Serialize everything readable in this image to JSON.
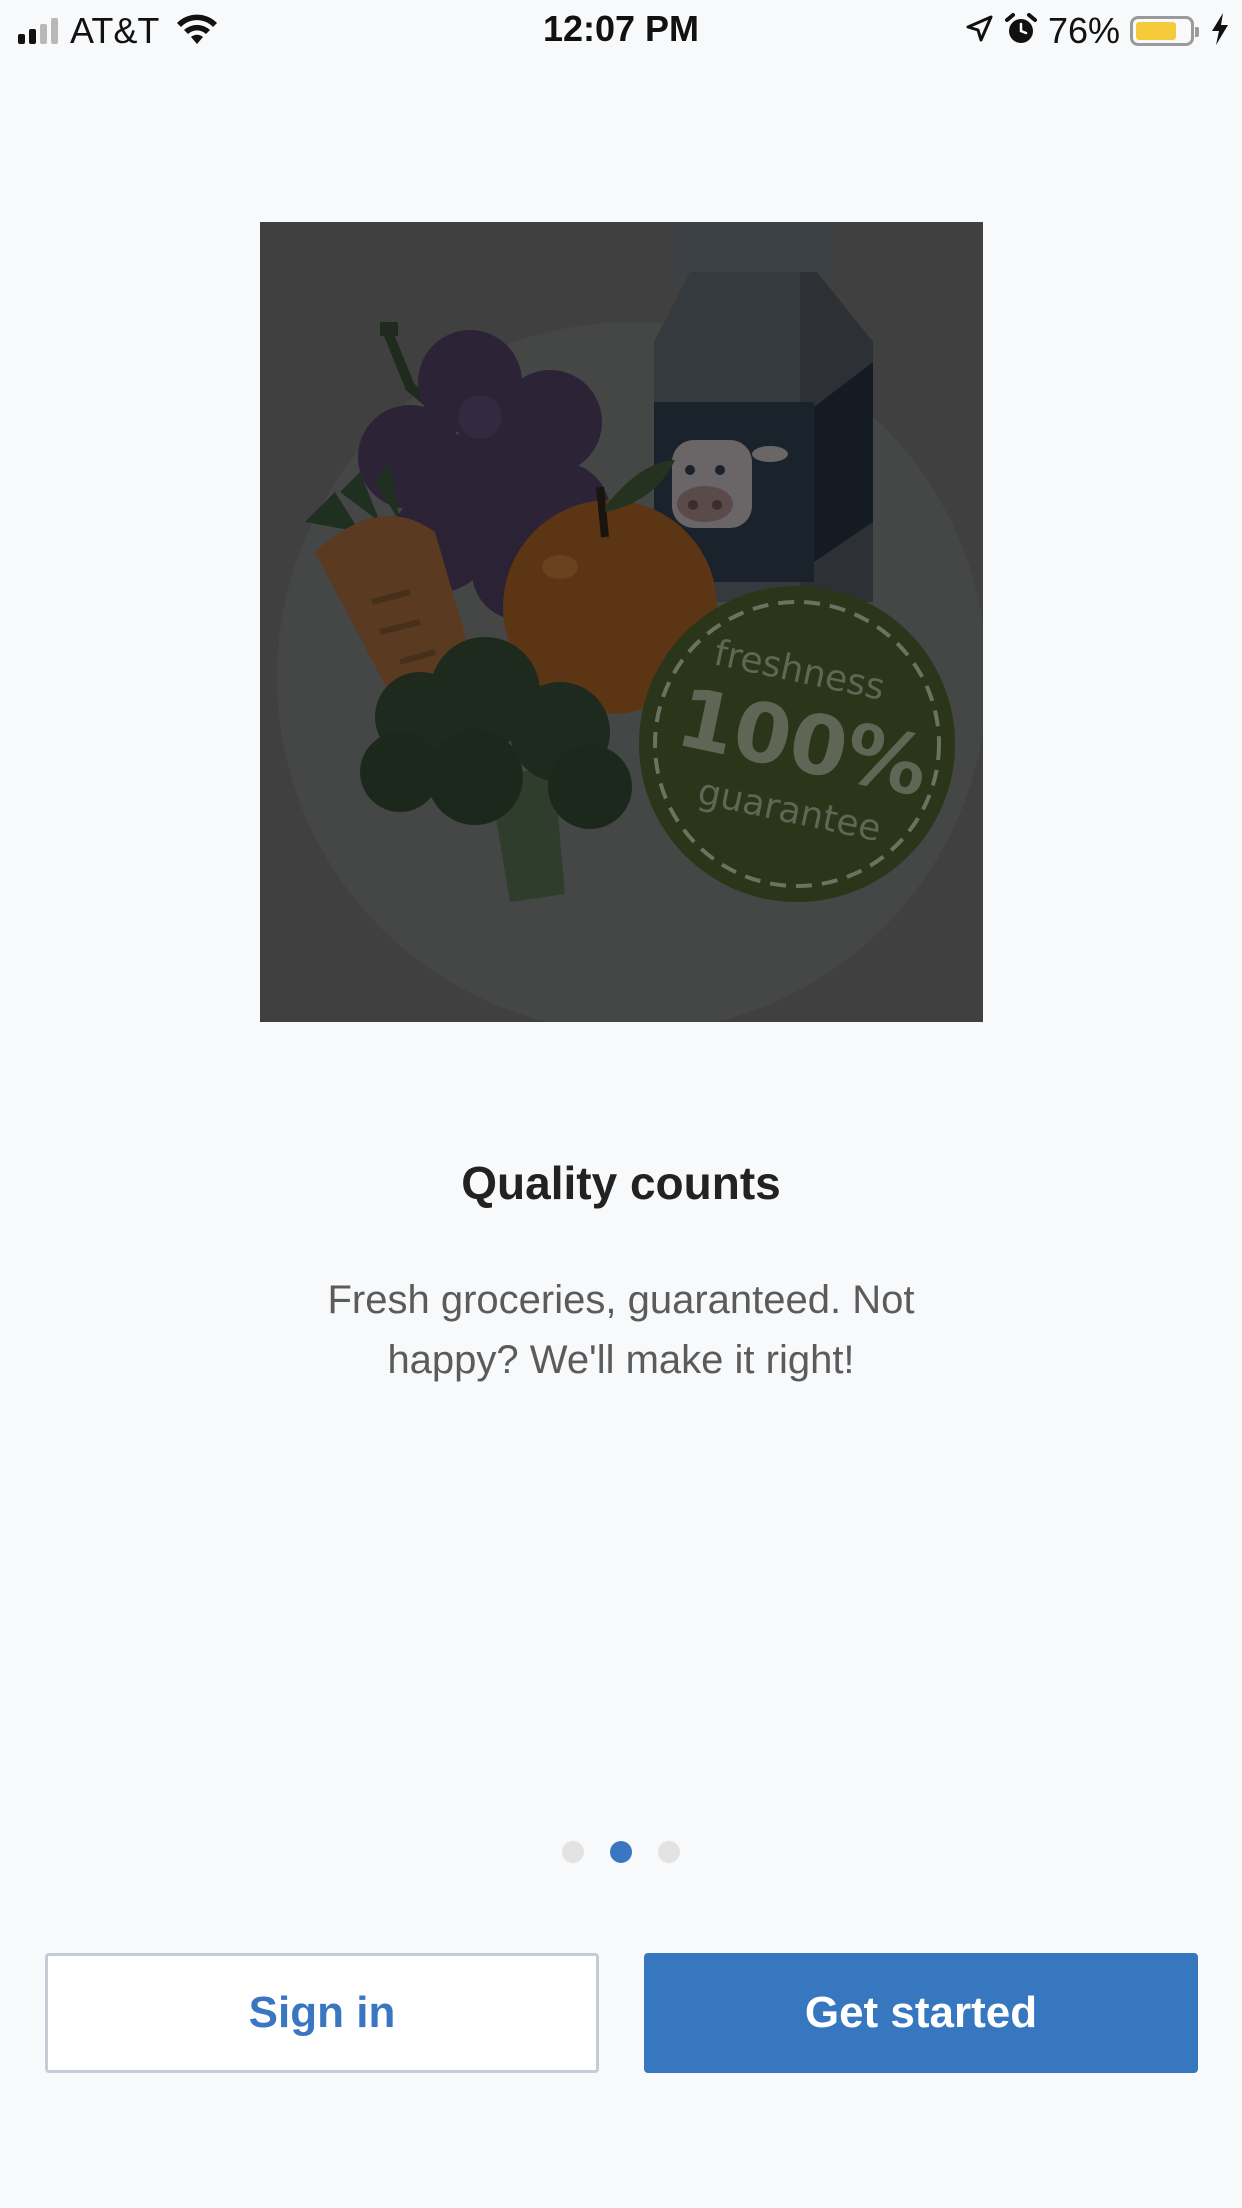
{
  "status_bar": {
    "carrier": "AT&T",
    "time": "12:07 PM",
    "battery_percent": "76%",
    "battery_level": 0.76,
    "icons": [
      "signal-icon",
      "wifi-icon",
      "location-icon",
      "alarm-icon",
      "battery-icon",
      "charging-icon"
    ]
  },
  "onboarding": {
    "illustration": {
      "badge_top": "freshness",
      "badge_value": "100%",
      "badge_bottom": "guarantee"
    },
    "title": "Quality counts",
    "subtitle": "Fresh groceries, guaranteed. Not happy? We'll make it right!",
    "pager": {
      "pages": 3,
      "current": 2
    }
  },
  "actions": {
    "sign_in_label": "Sign in",
    "get_started_label": "Get started"
  },
  "colors": {
    "accent": "#3677c0",
    "background": "#f8f9fa",
    "overlay": "#404040",
    "battery": "#f6cb3b"
  }
}
